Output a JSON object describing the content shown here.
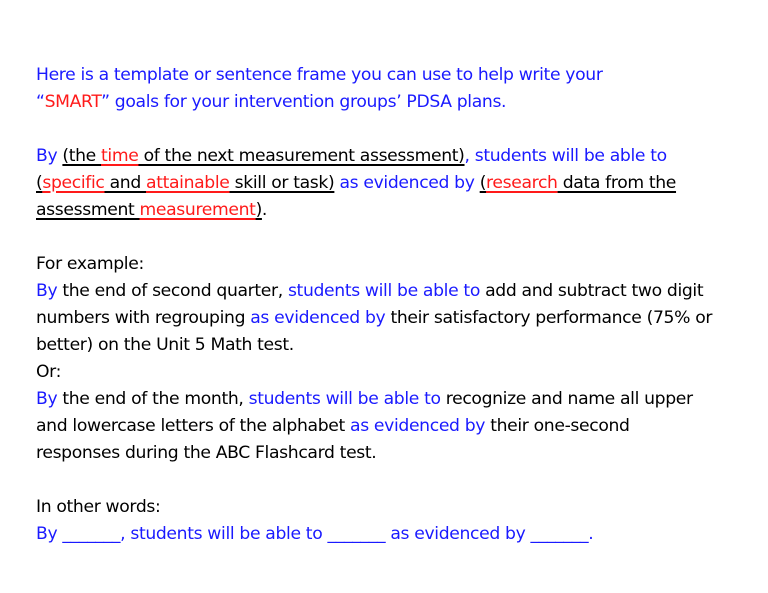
{
  "intro": {
    "line1": "Here is a template or sentence frame you can use to help write your",
    "quote_open": "“",
    "smart": "SMART",
    "quote_close": "”",
    "line2_rest": " goals for your intervention groups’ PDSA plans."
  },
  "template": {
    "by": "By",
    "paren1_open": "(the ",
    "time": "time",
    "paren1_rest": " of the next measurement assessment)",
    "comma": ", ",
    "students": "students will be able to",
    "paren2_open": "(",
    "specific": "specific",
    "and": " and ",
    "attainable": "attainable",
    "paren2_rest": " skill or task)",
    "evidenced": " as evidenced by ",
    "paren3_open": "(",
    "research": "research",
    "paren3_mid": " data from the assessment ",
    "measurement": "measurement",
    "paren3_close": ")",
    "period": "."
  },
  "example1": {
    "heading": "For example:",
    "by": "By",
    "t1": " the end of second quarter, ",
    "students": "students will be able to",
    "t2": " add and subtract two digit numbers with regrouping ",
    "evidenced": "as evidenced by",
    "t3": " their satisfactory performance (75% or better) on the Unit 5 Math test."
  },
  "example2": {
    "heading": "Or:",
    "by": "By",
    "t1": " the end of the month, ",
    "students": "students will be able to",
    "t2": " recognize and name all upper and lowercase letters of the alphabet ",
    "evidenced": "as evidenced by",
    "t3": " their one-second responses during the ABC Flashcard test."
  },
  "summary": {
    "heading": "In other words:",
    "sentence_parts": [
      "By ",
      "_______",
      ", students will be able to ",
      "_______",
      " as evidenced by ",
      "_______",
      "."
    ]
  },
  "colors": {
    "blue": "#1a1aff",
    "red": "#ff1a1a",
    "black": "#000000"
  }
}
